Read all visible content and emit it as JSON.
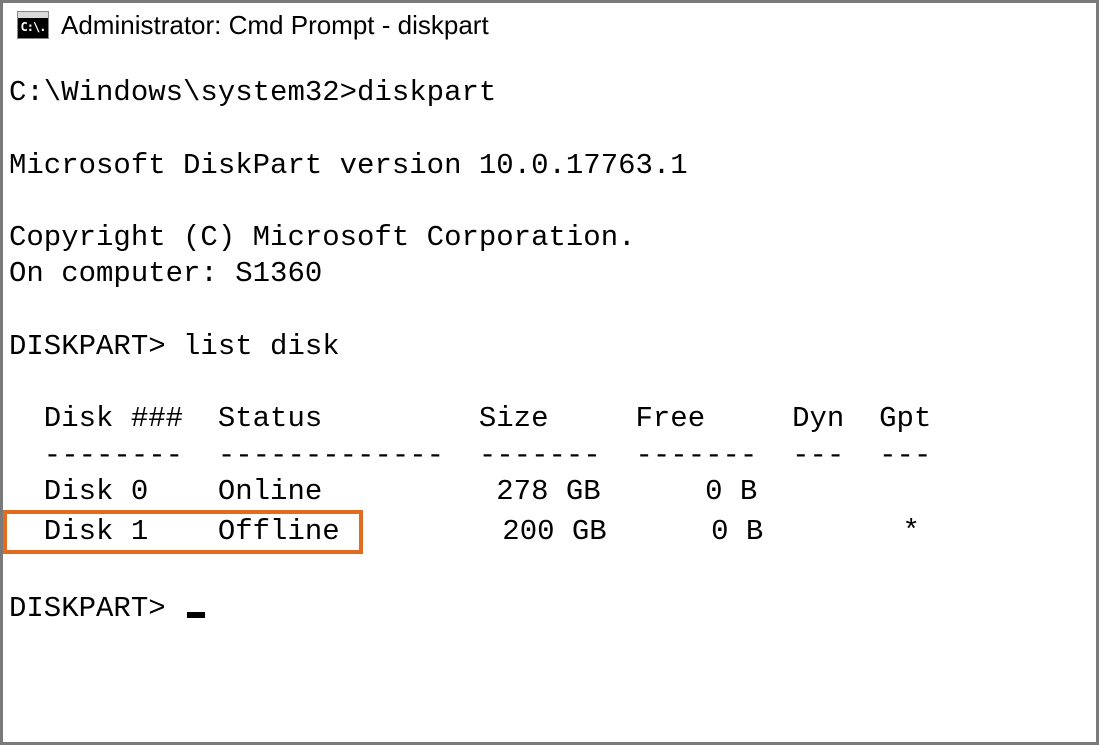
{
  "window": {
    "title": "Administrator: Cmd Prompt - diskpart",
    "icon_label": "C:\\."
  },
  "terminal": {
    "prompt_line": "C:\\Windows\\system32>diskpart",
    "blank": "",
    "version_line": "Microsoft DiskPart version 10.0.17763.1",
    "copyright_line": "Copyright (C) Microsoft Corporation.",
    "computer_line": "On computer: S1360",
    "diskpart_prompt": "DISKPART> ",
    "list_disk_cmd": "list disk",
    "table": {
      "header": "  Disk ###  Status         Size     Free     Dyn  Gpt",
      "divider": "  --------  -------------  -------  -------  ---  ---",
      "rows": [
        {
          "text": "  Disk 0    Online          278 GB      0 B",
          "highlighted_part": "",
          "rest": ""
        }
      ],
      "highlighted_row": {
        "highlight": "  Disk 1    Offline ",
        "rest": "        200 GB      0 B        *"
      }
    },
    "final_prompt": "DISKPART> "
  }
}
